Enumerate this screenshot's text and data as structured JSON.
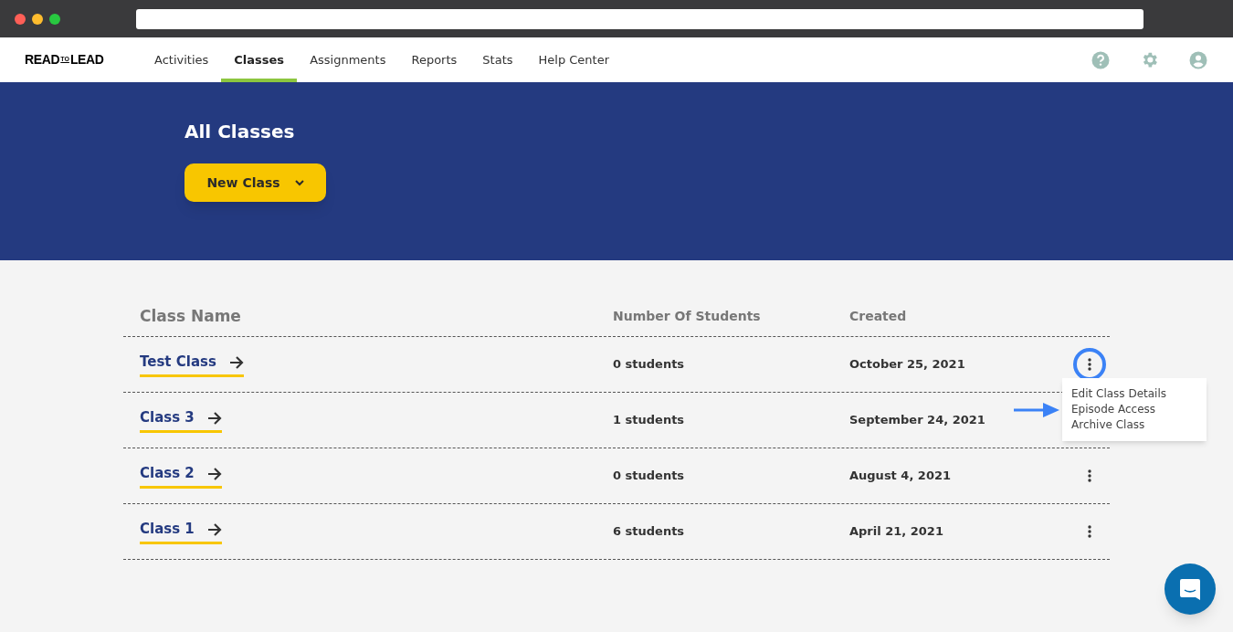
{
  "logo": {
    "word_1": "READ",
    "word_2": "TO",
    "word_3": "LEAD"
  },
  "nav": [
    {
      "label": "Activities",
      "selected": false
    },
    {
      "label": "Classes",
      "selected": true
    },
    {
      "label": "Assignments",
      "selected": false
    },
    {
      "label": "Reports",
      "selected": false
    },
    {
      "label": "Stats",
      "selected": false
    },
    {
      "label": "Help Center",
      "selected": false
    }
  ],
  "banner": {
    "title": "All Classes",
    "button": "New Class"
  },
  "table": {
    "columns": [
      "Class Name",
      "Number Of Students",
      "Created"
    ],
    "rows": [
      {
        "name": "Test Class",
        "students": "0 students",
        "created": "October 25, 2021",
        "menu_open": true
      },
      {
        "name": "Class 3",
        "students": "1 students",
        "created": "September 24, 2021",
        "menu_open": false
      },
      {
        "name": "Class 2",
        "students": "0 students",
        "created": "August 4, 2021",
        "menu_open": false
      },
      {
        "name": "Class 1",
        "students": "6 students",
        "created": "April 21, 2021",
        "menu_open": false
      }
    ]
  },
  "row_menu": [
    {
      "label": "Edit Class Details",
      "pointed": false
    },
    {
      "label": "Episode Access",
      "pointed": true
    },
    {
      "label": "Archive Class",
      "pointed": false
    }
  ]
}
